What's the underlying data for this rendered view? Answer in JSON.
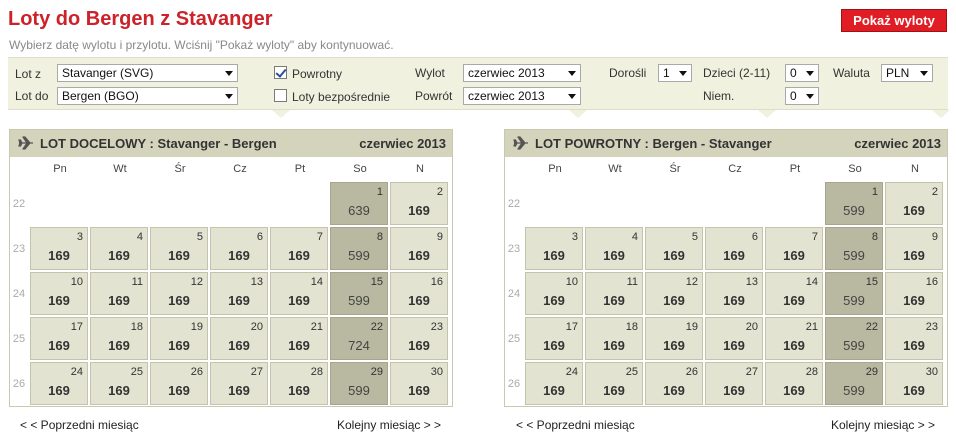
{
  "page": {
    "title": "Loty do Bergen z Stavanger",
    "subtitle": "Wybierz datę wylotu i przylotu. Wciśnij \"Pokaż wyloty\" aby kontynuować.",
    "show_button": "Pokaż wyloty"
  },
  "form": {
    "from_label": "Lot z",
    "from_value": "Stavanger (SVG)",
    "to_label": "Lot do",
    "to_value": "Bergen (BGO)",
    "return_label": "Powrotny",
    "return_checked": true,
    "direct_label": "Loty bezpośrednie",
    "direct_checked": false,
    "depart_label": "Wylot",
    "depart_value": "czerwiec 2013",
    "return_date_label": "Powrót",
    "return_date_value": "czerwiec 2013",
    "adults_label": "Dorośli",
    "adults_value": "1",
    "children_label": "Dzieci (2-11)",
    "children_value": "0",
    "infants_label": "Niem.",
    "infants_value": "0",
    "currency_label": "Waluta",
    "currency_value": "PLN"
  },
  "weekdays": [
    "Pn",
    "Wt",
    "Śr",
    "Cz",
    "Pt",
    "So",
    "N"
  ],
  "week_numbers": [
    "22",
    "23",
    "24",
    "25",
    "26"
  ],
  "calendars": [
    {
      "heading": "LOT DOCELOWY :  Stavanger - Bergen",
      "month": "czerwiec 2013",
      "prev": "< < Poprzedni miesiąc",
      "next": "Kolejny miesiąc > >",
      "days": [
        {
          "day": "1",
          "price": "639",
          "col": 5,
          "row": 0,
          "hi": true
        },
        {
          "day": "2",
          "price": "169",
          "col": 6,
          "row": 0,
          "hi": false
        },
        {
          "day": "3",
          "price": "169",
          "col": 0,
          "row": 1,
          "hi": false
        },
        {
          "day": "4",
          "price": "169",
          "col": 1,
          "row": 1,
          "hi": false
        },
        {
          "day": "5",
          "price": "169",
          "col": 2,
          "row": 1,
          "hi": false
        },
        {
          "day": "6",
          "price": "169",
          "col": 3,
          "row": 1,
          "hi": false
        },
        {
          "day": "7",
          "price": "169",
          "col": 4,
          "row": 1,
          "hi": false
        },
        {
          "day": "8",
          "price": "599",
          "col": 5,
          "row": 1,
          "hi": true
        },
        {
          "day": "9",
          "price": "169",
          "col": 6,
          "row": 1,
          "hi": false
        },
        {
          "day": "10",
          "price": "169",
          "col": 0,
          "row": 2,
          "hi": false
        },
        {
          "day": "11",
          "price": "169",
          "col": 1,
          "row": 2,
          "hi": false
        },
        {
          "day": "12",
          "price": "169",
          "col": 2,
          "row": 2,
          "hi": false
        },
        {
          "day": "13",
          "price": "169",
          "col": 3,
          "row": 2,
          "hi": false
        },
        {
          "day": "14",
          "price": "169",
          "col": 4,
          "row": 2,
          "hi": false
        },
        {
          "day": "15",
          "price": "599",
          "col": 5,
          "row": 2,
          "hi": true
        },
        {
          "day": "16",
          "price": "169",
          "col": 6,
          "row": 2,
          "hi": false
        },
        {
          "day": "17",
          "price": "169",
          "col": 0,
          "row": 3,
          "hi": false
        },
        {
          "day": "18",
          "price": "169",
          "col": 1,
          "row": 3,
          "hi": false
        },
        {
          "day": "19",
          "price": "169",
          "col": 2,
          "row": 3,
          "hi": false
        },
        {
          "day": "20",
          "price": "169",
          "col": 3,
          "row": 3,
          "hi": false
        },
        {
          "day": "21",
          "price": "169",
          "col": 4,
          "row": 3,
          "hi": false
        },
        {
          "day": "22",
          "price": "724",
          "col": 5,
          "row": 3,
          "hi": true
        },
        {
          "day": "23",
          "price": "169",
          "col": 6,
          "row": 3,
          "hi": false
        },
        {
          "day": "24",
          "price": "169",
          "col": 0,
          "row": 4,
          "hi": false
        },
        {
          "day": "25",
          "price": "169",
          "col": 1,
          "row": 4,
          "hi": false
        },
        {
          "day": "26",
          "price": "169",
          "col": 2,
          "row": 4,
          "hi": false
        },
        {
          "day": "27",
          "price": "169",
          "col": 3,
          "row": 4,
          "hi": false
        },
        {
          "day": "28",
          "price": "169",
          "col": 4,
          "row": 4,
          "hi": false
        },
        {
          "day": "29",
          "price": "599",
          "col": 5,
          "row": 4,
          "hi": true
        },
        {
          "day": "30",
          "price": "169",
          "col": 6,
          "row": 4,
          "hi": false
        }
      ]
    },
    {
      "heading": "LOT POWROTNY :  Bergen - Stavanger",
      "month": "czerwiec 2013",
      "prev": "< < Poprzedni miesiąc",
      "next": "Kolejny miesiąc > >",
      "days": [
        {
          "day": "1",
          "price": "599",
          "col": 5,
          "row": 0,
          "hi": true
        },
        {
          "day": "2",
          "price": "169",
          "col": 6,
          "row": 0,
          "hi": false
        },
        {
          "day": "3",
          "price": "169",
          "col": 0,
          "row": 1,
          "hi": false
        },
        {
          "day": "4",
          "price": "169",
          "col": 1,
          "row": 1,
          "hi": false
        },
        {
          "day": "5",
          "price": "169",
          "col": 2,
          "row": 1,
          "hi": false
        },
        {
          "day": "6",
          "price": "169",
          "col": 3,
          "row": 1,
          "hi": false
        },
        {
          "day": "7",
          "price": "169",
          "col": 4,
          "row": 1,
          "hi": false
        },
        {
          "day": "8",
          "price": "599",
          "col": 5,
          "row": 1,
          "hi": true
        },
        {
          "day": "9",
          "price": "169",
          "col": 6,
          "row": 1,
          "hi": false
        },
        {
          "day": "10",
          "price": "169",
          "col": 0,
          "row": 2,
          "hi": false
        },
        {
          "day": "11",
          "price": "169",
          "col": 1,
          "row": 2,
          "hi": false
        },
        {
          "day": "12",
          "price": "169",
          "col": 2,
          "row": 2,
          "hi": false
        },
        {
          "day": "13",
          "price": "169",
          "col": 3,
          "row": 2,
          "hi": false
        },
        {
          "day": "14",
          "price": "169",
          "col": 4,
          "row": 2,
          "hi": false
        },
        {
          "day": "15",
          "price": "599",
          "col": 5,
          "row": 2,
          "hi": true
        },
        {
          "day": "16",
          "price": "169",
          "col": 6,
          "row": 2,
          "hi": false
        },
        {
          "day": "17",
          "price": "169",
          "col": 0,
          "row": 3,
          "hi": false
        },
        {
          "day": "18",
          "price": "169",
          "col": 1,
          "row": 3,
          "hi": false
        },
        {
          "day": "19",
          "price": "169",
          "col": 2,
          "row": 3,
          "hi": false
        },
        {
          "day": "20",
          "price": "169",
          "col": 3,
          "row": 3,
          "hi": false
        },
        {
          "day": "21",
          "price": "169",
          "col": 4,
          "row": 3,
          "hi": false
        },
        {
          "day": "22",
          "price": "599",
          "col": 5,
          "row": 3,
          "hi": true
        },
        {
          "day": "23",
          "price": "169",
          "col": 6,
          "row": 3,
          "hi": false
        },
        {
          "day": "24",
          "price": "169",
          "col": 0,
          "row": 4,
          "hi": false
        },
        {
          "day": "25",
          "price": "169",
          "col": 1,
          "row": 4,
          "hi": false
        },
        {
          "day": "26",
          "price": "169",
          "col": 2,
          "row": 4,
          "hi": false
        },
        {
          "day": "27",
          "price": "169",
          "col": 3,
          "row": 4,
          "hi": false
        },
        {
          "day": "28",
          "price": "169",
          "col": 4,
          "row": 4,
          "hi": false
        },
        {
          "day": "29",
          "price": "599",
          "col": 5,
          "row": 4,
          "hi": true
        },
        {
          "day": "30",
          "price": "169",
          "col": 6,
          "row": 4,
          "hi": false
        }
      ]
    }
  ]
}
